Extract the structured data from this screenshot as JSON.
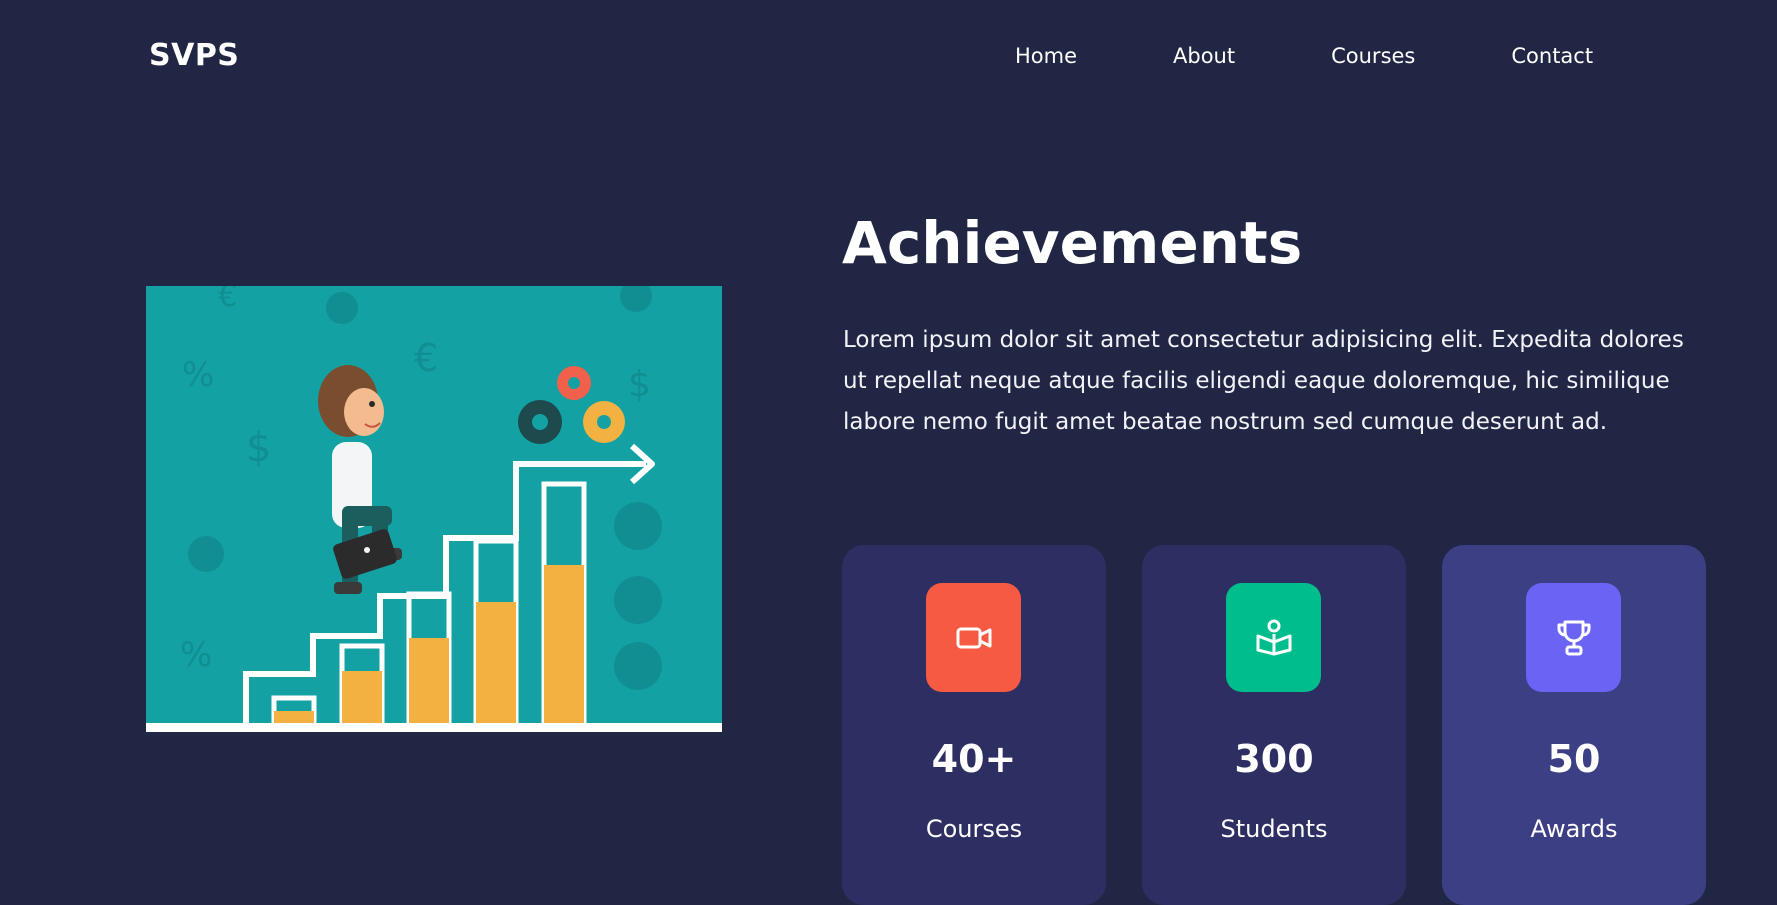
{
  "navbar": {
    "logo": "SVPS",
    "links": [
      "Home",
      "About",
      "Courses",
      "Contact"
    ]
  },
  "hero": {
    "illustration_icon": "career-growth-illustration",
    "title": "Achievements",
    "description": "Lorem ipsum dolor sit amet consectetur adipisicing elit. Expedita dolores ut repellat neque atque facilis eligendi eaque doloremque, hic similique labore nemo fugit amet beatae nostrum sed cumque deserunt ad."
  },
  "stats": [
    {
      "value": "40+",
      "label": "Courses",
      "icon": "video-camera-icon",
      "icon_bg": "#f65a43",
      "card_bg": "#2d2f63"
    },
    {
      "value": "300",
      "label": "Students",
      "icon": "student-reading-icon",
      "icon_bg": "#00bd8e",
      "card_bg": "#2d2f63"
    },
    {
      "value": "50",
      "label": "Awards",
      "icon": "trophy-icon",
      "icon_bg": "#6a63f4",
      "card_bg": "#3c3f83"
    }
  ],
  "colors": {
    "page_bg": "#202644",
    "illustration_bg": "#13a1a3",
    "bar_color": "#f2b141"
  }
}
